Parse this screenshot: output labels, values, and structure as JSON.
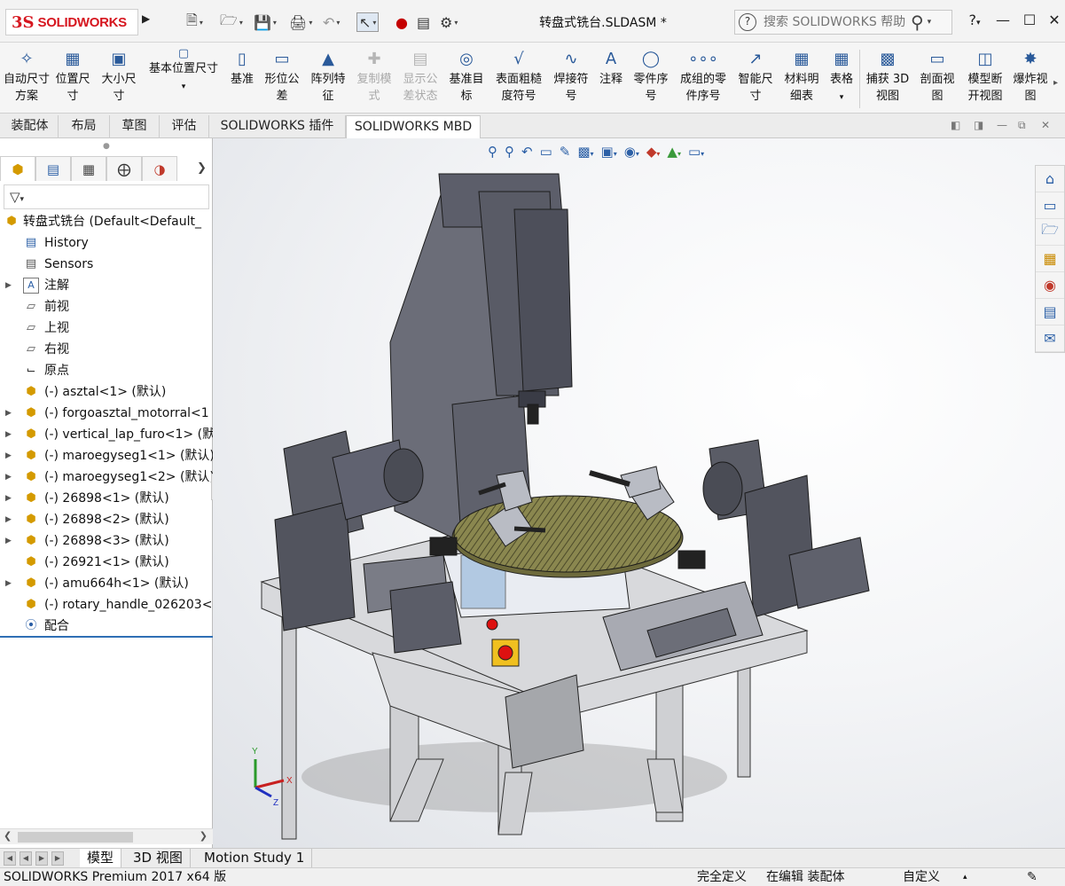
{
  "titlebar": {
    "logo_ds": "3S",
    "logo_text": "SOLIDWORKS",
    "document_title": "转盘式铣台.SLDASM *",
    "search_placeholder": "搜索 SOLIDWORKS 帮助",
    "help_label": "?",
    "quick_access_icons": [
      "new-document-icon",
      "open-icon",
      "save-icon",
      "print-icon",
      "undo-icon",
      "select-icon",
      "rebuild-icon",
      "file-properties-icon",
      "options-icon"
    ]
  },
  "ribbon": {
    "buttons": [
      {
        "label": "自动尺寸方案",
        "icon": "auto-dimension-icon",
        "enabled": true
      },
      {
        "label": "位置尺寸",
        "icon": "location-dimension-icon",
        "enabled": true
      },
      {
        "label": "大小尺寸",
        "icon": "size-dimension-icon",
        "enabled": true
      },
      {
        "label": "基本位置尺寸",
        "icon": "basic-location-dimension-icon",
        "enabled": true
      },
      {
        "label": "基准",
        "icon": "datum-icon",
        "enabled": true
      },
      {
        "label": "形位公差",
        "icon": "geometric-tolerance-icon",
        "enabled": true
      },
      {
        "label": "阵列特征",
        "icon": "pattern-feature-icon",
        "enabled": true
      },
      {
        "label": "复制模式",
        "icon": "copy-scheme-icon",
        "enabled": false
      },
      {
        "label": "显示公差状态",
        "icon": "show-tolerance-status-icon",
        "enabled": false
      },
      {
        "label": "基准目标",
        "icon": "datum-target-icon",
        "enabled": true
      },
      {
        "label": "表面粗糙度符号",
        "icon": "surface-finish-icon",
        "enabled": true
      },
      {
        "label": "焊接符号",
        "icon": "weld-symbol-icon",
        "enabled": true
      },
      {
        "label": "注释",
        "icon": "note-icon",
        "enabled": true
      },
      {
        "label": "零件序号",
        "icon": "balloon-icon",
        "enabled": true
      },
      {
        "label": "成组的零件序号",
        "icon": "stacked-balloon-icon",
        "enabled": true
      },
      {
        "label": "智能尺寸",
        "icon": "smart-dimension-icon",
        "enabled": true
      },
      {
        "label": "材料明细表",
        "icon": "bill-of-materials-icon",
        "enabled": true
      },
      {
        "label": "表格",
        "icon": "table-icon",
        "enabled": true
      },
      {
        "label": "捕获 3D 视图",
        "icon": "capture-3d-view-icon",
        "enabled": true
      },
      {
        "label": "剖面视图",
        "icon": "section-view-icon",
        "enabled": true
      },
      {
        "label": "模型断开视图",
        "icon": "model-break-view-icon",
        "enabled": true
      },
      {
        "label": "爆炸视图",
        "icon": "exploded-view-icon",
        "enabled": true
      }
    ]
  },
  "command_tabs": [
    "装配体",
    "布局",
    "草图",
    "评估",
    "SOLIDWORKS 插件",
    "SOLIDWORKS MBD"
  ],
  "active_command_tab": "SOLIDWORKS MBD",
  "feature_manager": {
    "tabs": [
      "feature-manager-icon",
      "property-manager-icon",
      "configuration-manager-icon",
      "dimxpert-icon",
      "display-manager-icon"
    ],
    "tree": [
      {
        "label": "转盘式铣台  (Default<Default_",
        "icon": "assembly-icon",
        "expandable": false,
        "level": 0
      },
      {
        "label": "History",
        "icon": "history-icon",
        "expandable": false,
        "level": 1
      },
      {
        "label": "Sensors",
        "icon": "sensors-icon",
        "expandable": false,
        "level": 1
      },
      {
        "label": "注解",
        "icon": "annotations-icon",
        "expandable": true,
        "level": 1
      },
      {
        "label": "前视",
        "icon": "plane-icon",
        "expandable": false,
        "level": 1
      },
      {
        "label": "上视",
        "icon": "plane-icon",
        "expandable": false,
        "level": 1
      },
      {
        "label": "右视",
        "icon": "plane-icon",
        "expandable": false,
        "level": 1
      },
      {
        "label": "原点",
        "icon": "origin-icon",
        "expandable": false,
        "level": 1
      },
      {
        "label": "(-) asztal<1> (默认)",
        "icon": "part-icon",
        "expandable": false,
        "level": 1
      },
      {
        "label": "(-) forgoasztal_motorral<1",
        "icon": "subassembly-icon",
        "expandable": true,
        "level": 1
      },
      {
        "label": "(-) vertical_lap_furo<1> (默",
        "icon": "subassembly-icon",
        "expandable": true,
        "level": 1
      },
      {
        "label": "(-) maroegyseg1<1> (默认)",
        "icon": "subassembly-icon",
        "expandable": true,
        "level": 1
      },
      {
        "label": "(-) maroegyseg1<2> (默认)",
        "icon": "subassembly-icon",
        "expandable": true,
        "level": 1
      },
      {
        "label": "(-) 26898<1> (默认)",
        "icon": "subassembly-icon",
        "expandable": true,
        "level": 1
      },
      {
        "label": "(-) 26898<2> (默认)",
        "icon": "subassembly-icon",
        "expandable": true,
        "level": 1
      },
      {
        "label": "(-) 26898<3> (默认)",
        "icon": "subassembly-icon",
        "expandable": true,
        "level": 1
      },
      {
        "label": "(-) 26921<1> (默认)",
        "icon": "part-icon",
        "expandable": false,
        "level": 1
      },
      {
        "label": "(-) amu664h<1> (默认)",
        "icon": "subassembly-icon",
        "expandable": true,
        "level": 1
      },
      {
        "label": "(-) rotary_handle_026203<",
        "icon": "part-icon",
        "expandable": false,
        "level": 1
      },
      {
        "label": "配合",
        "icon": "mates-icon",
        "expandable": false,
        "level": 1
      }
    ]
  },
  "viewport": {
    "heads_up_icons": [
      "zoom-to-fit-icon",
      "zoom-to-area-icon",
      "previous-view-icon",
      "section-view-icon",
      "dynamic-annotation-icon",
      "view-orientation-icon",
      "display-style-icon",
      "hide-show-icon",
      "edit-appearance-icon",
      "apply-scene-icon",
      "view-settings-icon"
    ],
    "triad_axes": [
      "Y",
      "X",
      "Z"
    ],
    "model": "rotary-milling-table-assembly"
  },
  "task_pane": [
    "solidworks-resources-icon",
    "design-library-icon",
    "file-explorer-icon",
    "view-palette-icon",
    "appearances-icon",
    "custom-properties-icon",
    "forum-icon"
  ],
  "bottom_tabs": [
    "模型",
    "3D 视图",
    "Motion Study 1"
  ],
  "active_bottom_tab": "模型",
  "statusbar": {
    "product": "SOLIDWORKS Premium 2017 x64 版",
    "definition": "完全定义",
    "edit_state": "在编辑 装配体",
    "units": "自定义"
  }
}
